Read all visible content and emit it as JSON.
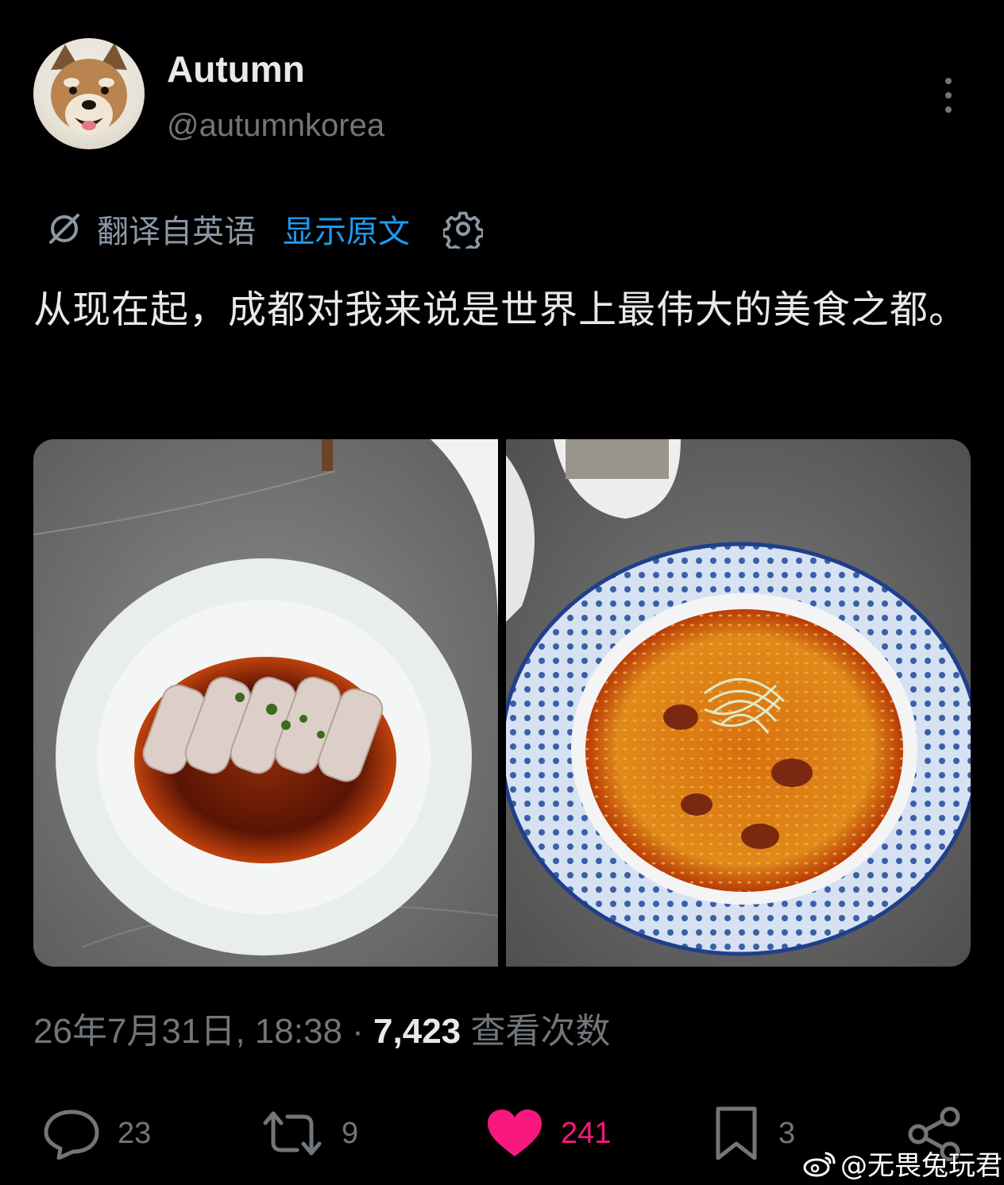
{
  "author": {
    "display_name": "Autumn",
    "handle": "@autumnkorea"
  },
  "translation": {
    "label": "翻译自英语",
    "show_original": "显示原文"
  },
  "tweet": {
    "text": "从现在起，成都对我来说是世界上最伟大的美食之都。"
  },
  "meta": {
    "timestamp": "26年7月31日, 18:38",
    "separator": "·",
    "views_count": "7,423",
    "views_label": "查看次数"
  },
  "actions": {
    "replies": "23",
    "reposts": "9",
    "likes": "241",
    "bookmarks": "3"
  },
  "watermark": {
    "text": "@无畏兔玩君"
  },
  "colors": {
    "background": "#000000",
    "text": "#e7e9ea",
    "secondary": "#71767b",
    "link": "#1d9bf0",
    "like": "#f91880"
  }
}
